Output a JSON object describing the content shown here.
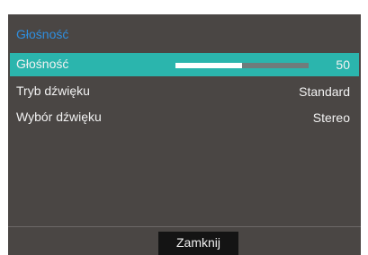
{
  "menu": {
    "title": "Głośność",
    "items": [
      {
        "label": "Głośność",
        "value": "50",
        "level_percent": 50,
        "selected": true
      },
      {
        "label": "Tryb dźwięku",
        "value": "Standard",
        "selected": false
      },
      {
        "label": "Wybór dźwięku",
        "value": "Stereo",
        "selected": false
      }
    ],
    "close_label": "Zamknij"
  },
  "colors": {
    "panel_bg": "#4a4644",
    "title": "#2f8fe0",
    "selected_row": "#2bb5ad",
    "slider_track": "#6f7c7c",
    "slider_fill": "#ffffff",
    "button_bg": "#141414"
  }
}
